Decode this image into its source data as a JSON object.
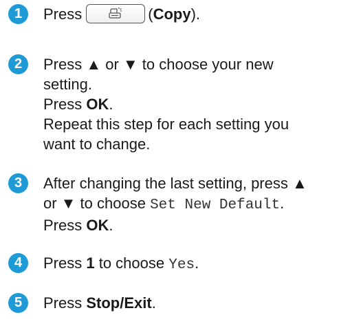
{
  "accent_color": "#1e9bd7",
  "steps": [
    {
      "number": "1",
      "lines": [
        {
          "pre": "Press",
          "icon": "copy-key-icon",
          "paren_open": "(",
          "bold": "Copy",
          "paren_close": ")."
        }
      ]
    },
    {
      "number": "2",
      "lines": [
        "Press ▲ or ▼ to choose your new",
        "setting.",
        {
          "pre": "Press ",
          "bold": "OK",
          "post": "."
        },
        "Repeat this step for each setting you",
        "want to change."
      ]
    },
    {
      "number": "3",
      "lines": [
        "After changing the last setting, press ▲",
        {
          "pre": "or ▼ to choose ",
          "code": "Set New Default",
          "post": "."
        },
        {
          "pre": "Press ",
          "bold": "OK",
          "post": "."
        }
      ]
    },
    {
      "number": "4",
      "lines": [
        {
          "pre": "Press ",
          "bold": "1",
          "mid": " to choose ",
          "code": "Yes",
          "post": "."
        }
      ]
    },
    {
      "number": "5",
      "lines": [
        {
          "pre": "Press ",
          "bold": "Stop/Exit",
          "post": "."
        }
      ]
    }
  ]
}
